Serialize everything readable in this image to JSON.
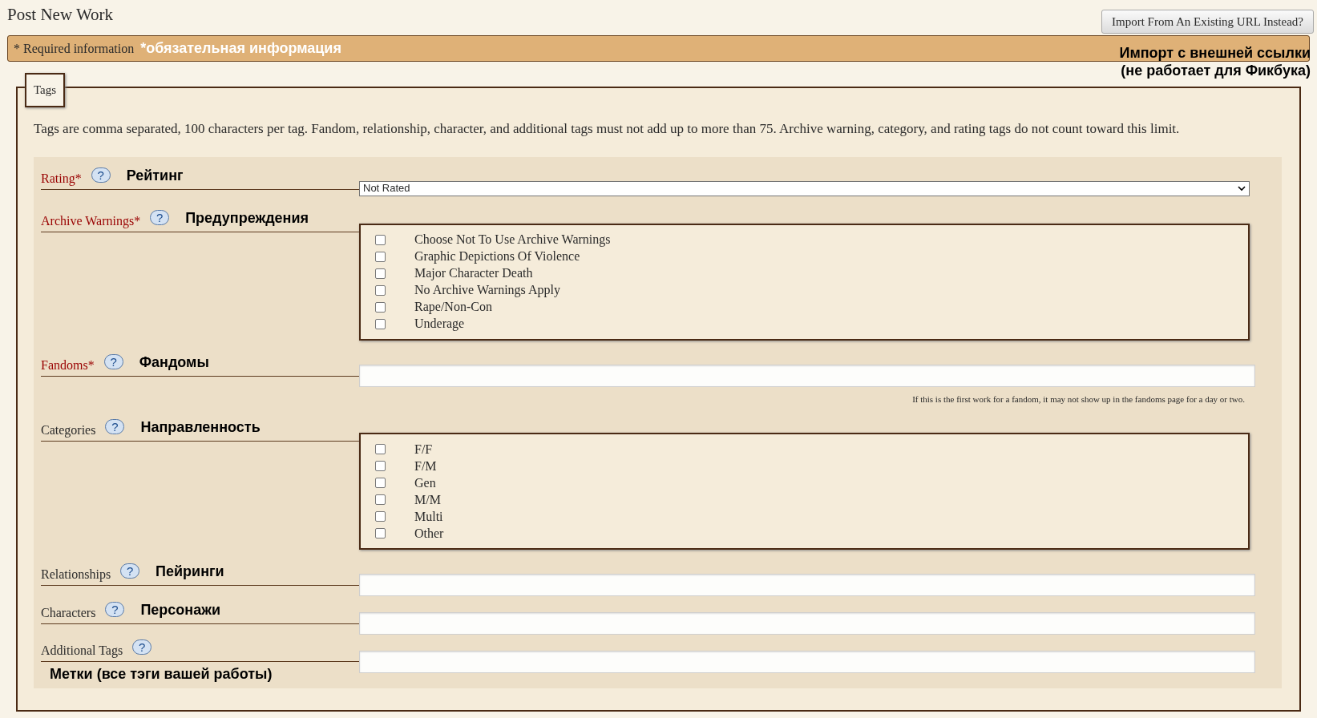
{
  "page_title": "Post New Work",
  "import_button": "Import From An Existing URL Instead?",
  "import_note": [
    "Импорт с внешней ссылки",
    "(не работает для Фикбука)"
  ],
  "required_bar": {
    "text": "* Required information",
    "annotation": "*обязательная информация"
  },
  "fieldset": {
    "legend": "Tags",
    "help_icon": "?",
    "intro": "Tags are comma separated, 100 characters per tag. Fandom, relationship, character, and additional tags must not add up to more than 75. Archive warning, category, and rating tags do not count toward this limit.",
    "fields": [
      {
        "kind": "select",
        "label": "Rating*",
        "required": true,
        "annotation": "Рейтинг",
        "annotation_below": false,
        "value": "Not Rated"
      },
      {
        "kind": "checkboxes",
        "label": "Archive Warnings*",
        "required": true,
        "annotation": "Предупреждения",
        "annotation_below": false,
        "options": [
          {
            "label": "Choose Not To Use Archive Warnings",
            "checked": false
          },
          {
            "label": "Graphic Depictions Of Violence",
            "checked": false
          },
          {
            "label": "Major Character Death",
            "checked": false
          },
          {
            "label": "No Archive Warnings Apply",
            "checked": false
          },
          {
            "label": "Rape/Non-Con",
            "checked": false
          },
          {
            "label": "Underage",
            "checked": false
          }
        ]
      },
      {
        "kind": "text",
        "label": "Fandoms*",
        "required": true,
        "annotation": "Фандомы",
        "annotation_below": false,
        "note": "If this is the first work for a fandom, it may not show up in the fandoms page for a day or two."
      },
      {
        "kind": "checkboxes",
        "label": "Categories",
        "required": false,
        "annotation": "Направленность",
        "annotation_below": false,
        "options": [
          {
            "label": "F/F",
            "checked": false
          },
          {
            "label": "F/M",
            "checked": false
          },
          {
            "label": "Gen",
            "checked": false
          },
          {
            "label": "M/M",
            "checked": false
          },
          {
            "label": "Multi",
            "checked": false
          },
          {
            "label": "Other",
            "checked": false
          }
        ]
      },
      {
        "kind": "text",
        "label": "Relationships",
        "required": false,
        "annotation": "Пейринги",
        "annotation_below": false
      },
      {
        "kind": "text",
        "label": "Characters",
        "required": false,
        "annotation": "Персонажи",
        "annotation_below": false
      },
      {
        "kind": "text",
        "label": "Additional Tags",
        "required": false,
        "annotation": "Метки (все тэги вашей работы)",
        "annotation_below": true
      }
    ]
  }
}
